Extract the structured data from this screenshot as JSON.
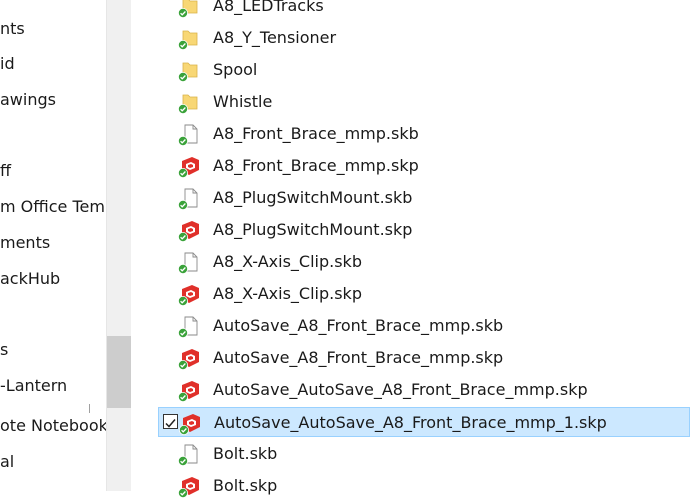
{
  "nav": {
    "items": [
      {
        "label": "nts"
      },
      {
        "label": "id"
      },
      {
        "label": "awings"
      },
      {
        "label": "ff"
      },
      {
        "label": "m Office Temp"
      },
      {
        "label": "ments"
      },
      {
        "label": "ackHub"
      },
      {
        "label": "s"
      },
      {
        "label": "-Lantern"
      },
      {
        "label": "ote Notebooks"
      },
      {
        "label": "al"
      }
    ]
  },
  "files": [
    {
      "name": "A8_LEDTracks",
      "icon": "folder-icon"
    },
    {
      "name": "A8_Y_Tensioner",
      "icon": "folder-icon"
    },
    {
      "name": "Spool",
      "icon": "folder-icon"
    },
    {
      "name": "Whistle",
      "icon": "folder-icon"
    },
    {
      "name": "A8_Front_Brace_mmp.skb",
      "icon": "blank-file-icon"
    },
    {
      "name": "A8_Front_Brace_mmp.skp",
      "icon": "sketchup-file-icon"
    },
    {
      "name": "A8_PlugSwitchMount.skb",
      "icon": "blank-file-icon"
    },
    {
      "name": "A8_PlugSwitchMount.skp",
      "icon": "sketchup-file-icon"
    },
    {
      "name": "A8_X-Axis_Clip.skb",
      "icon": "blank-file-icon"
    },
    {
      "name": "A8_X-Axis_Clip.skp",
      "icon": "sketchup-file-icon"
    },
    {
      "name": "AutoSave_A8_Front_Brace_mmp.skb",
      "icon": "blank-file-icon"
    },
    {
      "name": "AutoSave_A8_Front_Brace_mmp.skp",
      "icon": "sketchup-file-icon"
    },
    {
      "name": "AutoSave_AutoSave_A8_Front_Brace_mmp.skp",
      "icon": "sketchup-file-icon"
    },
    {
      "name": "AutoSave_AutoSave_A8_Front_Brace_mmp_1.skp",
      "icon": "sketchup-file-icon",
      "selected": true
    },
    {
      "name": "Bolt.skb",
      "icon": "blank-file-icon"
    },
    {
      "name": "Bolt.skp",
      "icon": "sketchup-file-icon"
    }
  ],
  "colors": {
    "selection_bg": "#cce8ff",
    "selection_border": "#99d1ff",
    "sync_green": "#3aa23a",
    "sketchup_red": "#e0302a",
    "folder_yellow": "#f8d775"
  }
}
